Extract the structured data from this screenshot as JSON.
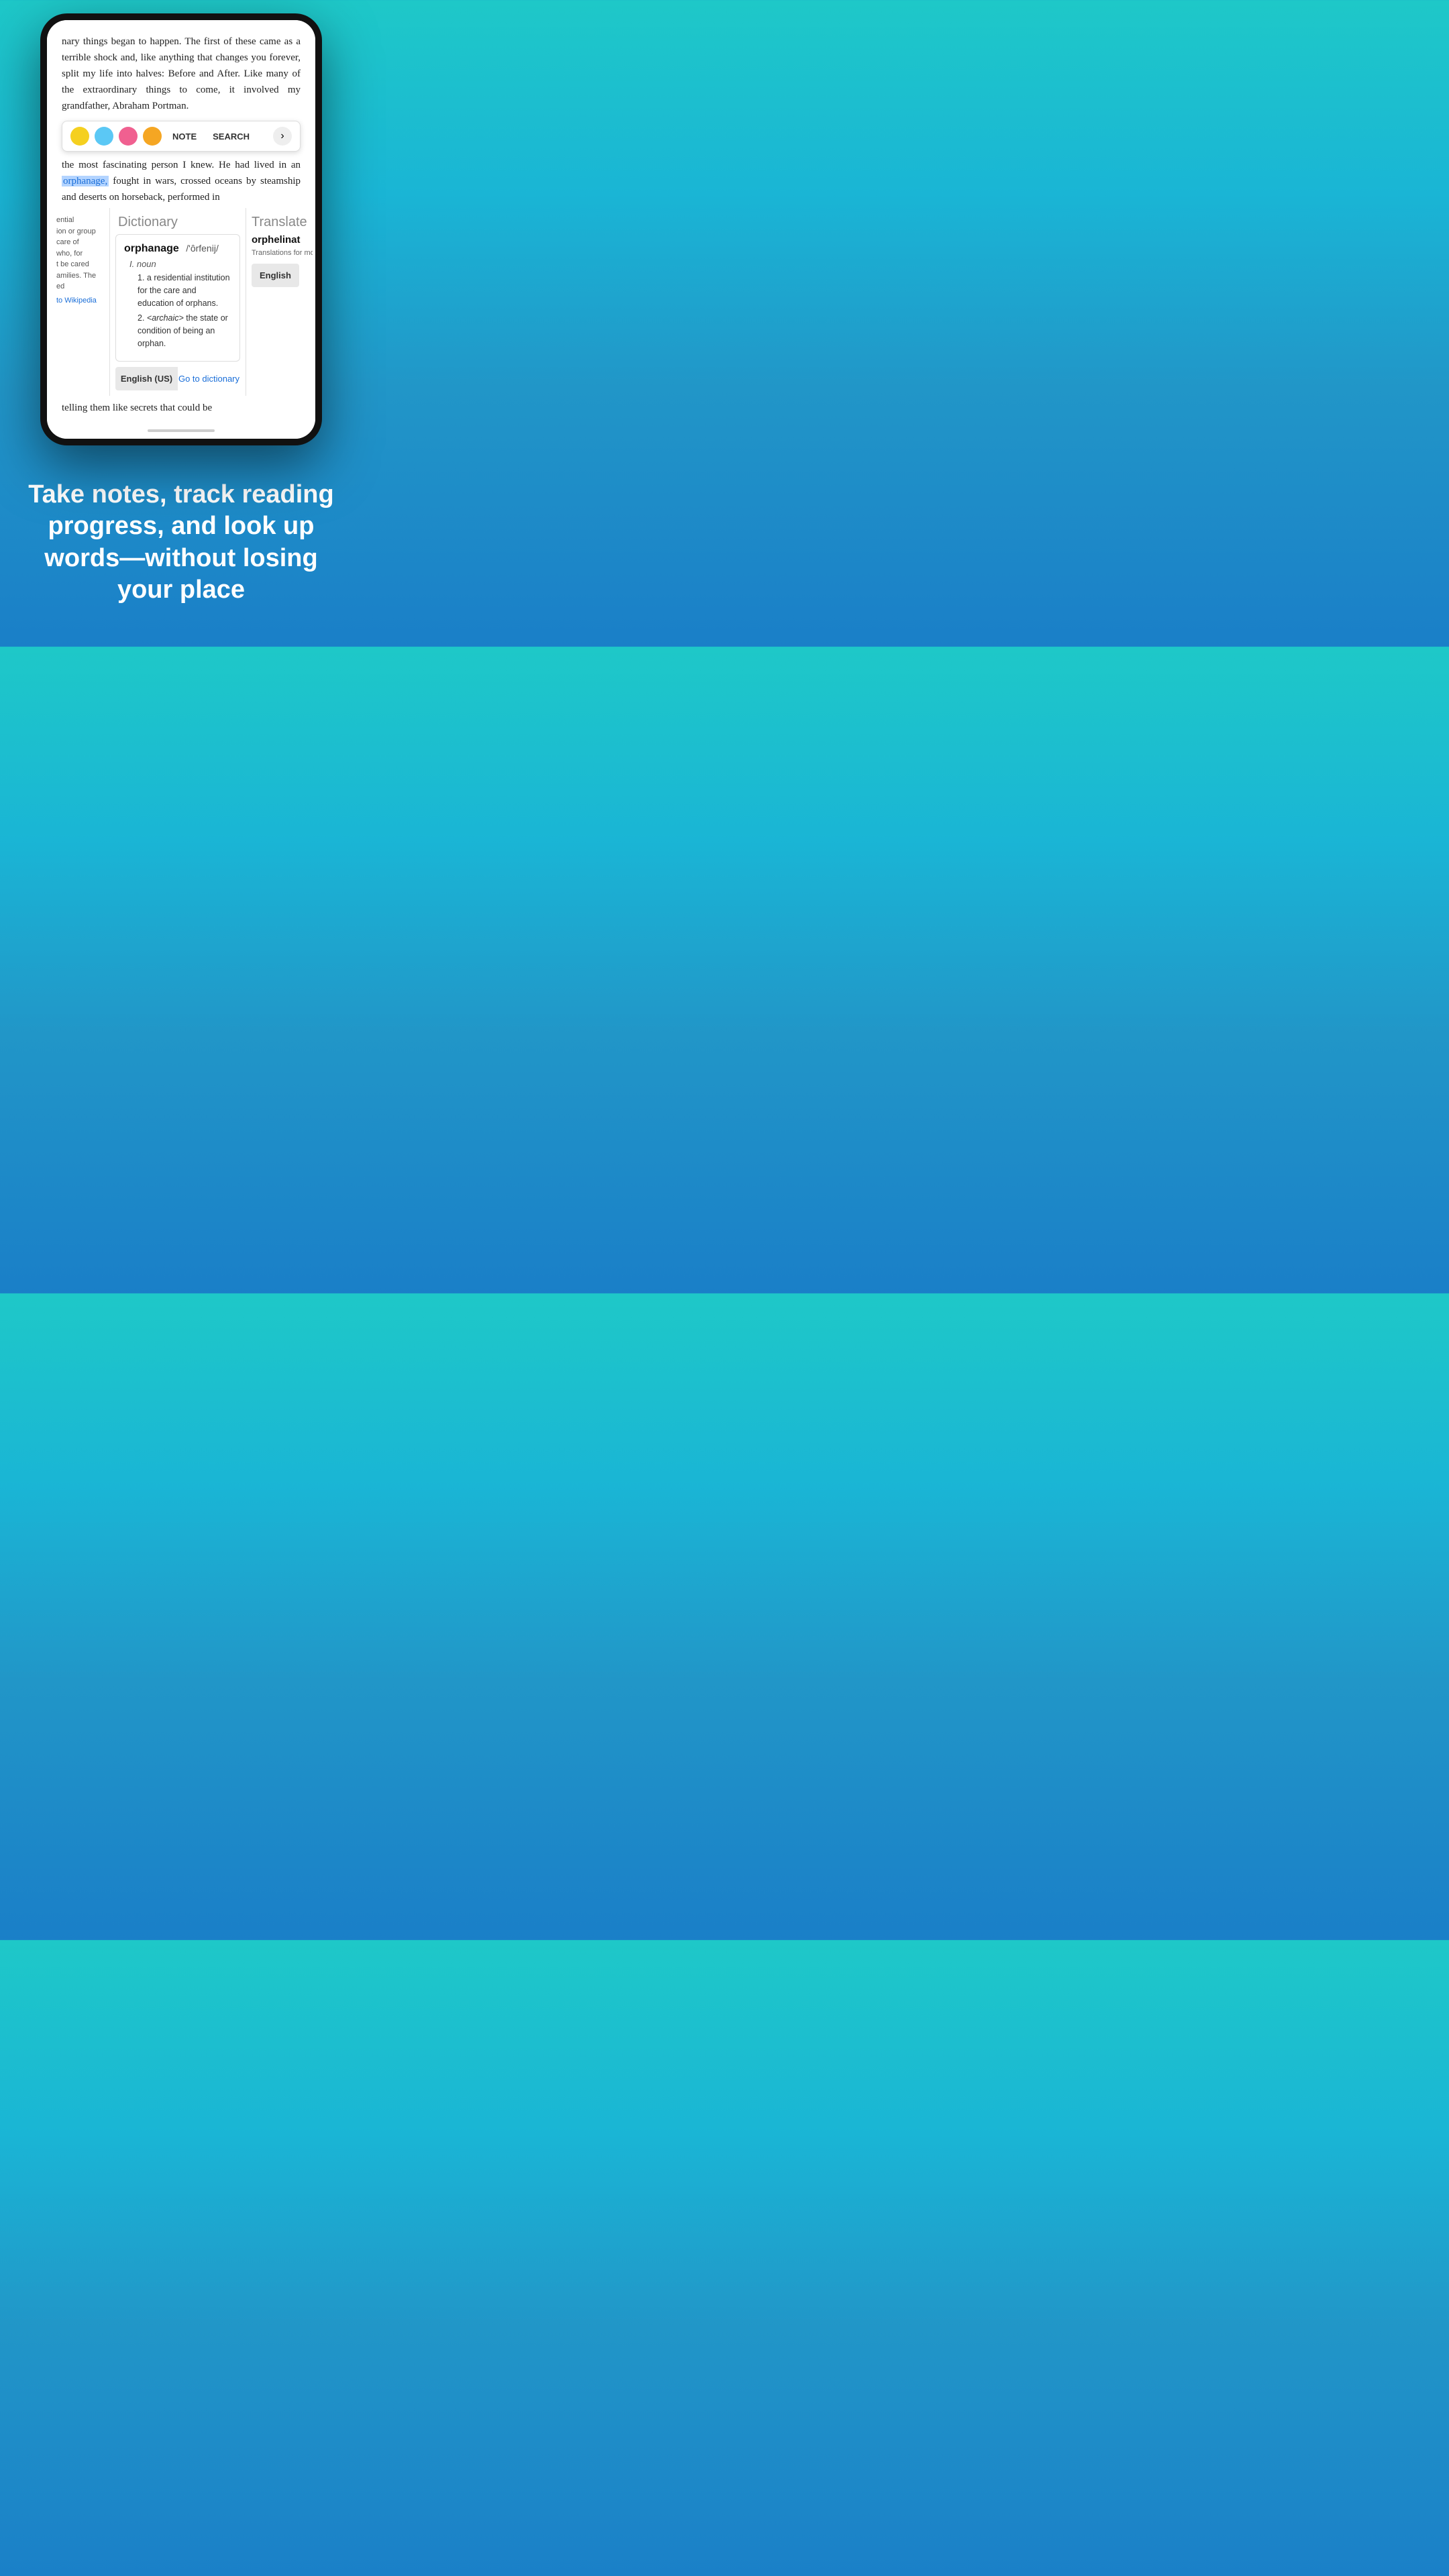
{
  "phone": {
    "book_text_top": "nary things began to happen. The first of these came as a terrible shock and, like anything that changes you forever, split my life into halves: Before and After. Like many of the extraordinary things to come, it involved my grandfather, Abraham Portman.",
    "book_text_mid_before": "the most fascinating",
    "book_text_mid_after": "person I knew. He had lived in an",
    "highlighted_word": "orphanage,",
    "book_text_mid_end": "fought in wars, crossed oceans by steamship and deserts on horseback, performed in",
    "highlight_colors": [
      "#f5d020",
      "#5bc8f5",
      "#f06090",
      "#f5a623"
    ],
    "toolbar_note": "NOTE",
    "toolbar_search": "SEARCH",
    "toolbar_arrow": "›",
    "left_panel": {
      "text_lines": [
        "ential",
        "ion or group",
        "care of",
        "who, for",
        "t be cared",
        "amilies. The",
        "ed"
      ],
      "wiki_link": "to Wikipedia"
    },
    "dictionary": {
      "header": "Dictionary",
      "word": "orphanage",
      "pronunciation": "/'ôrfenij/",
      "part_of_speech": "I. noun",
      "definitions": [
        "a residential institution for the care and education of orphans.",
        "<archaic> the state or condition of being an orphan."
      ],
      "footer_left": "English (US)",
      "footer_right": "Go to dictionary"
    },
    "translate": {
      "header": "Translate",
      "word": "orphelinat",
      "note": "Translations for more, visit w",
      "footer_btn": "English"
    },
    "book_text_bottom": "telling them like secrets that could be"
  },
  "marketing": {
    "text": "Take notes, track reading progress, and look up words—without losing your place"
  }
}
